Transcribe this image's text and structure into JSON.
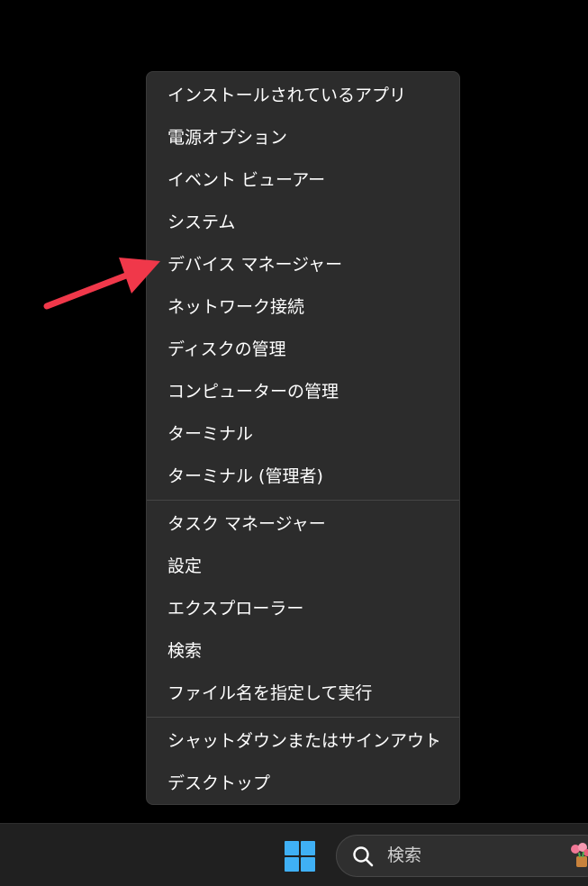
{
  "menu": {
    "group1": [
      {
        "name": "menu-item-installed-apps",
        "label": "インストールされているアプリ"
      },
      {
        "name": "menu-item-power-options",
        "label": "電源オプション"
      },
      {
        "name": "menu-item-event-viewer",
        "label": "イベント ビューアー"
      },
      {
        "name": "menu-item-system",
        "label": "システム"
      },
      {
        "name": "menu-item-device-manager",
        "label": "デバイス マネージャー"
      },
      {
        "name": "menu-item-network-connections",
        "label": "ネットワーク接続"
      },
      {
        "name": "menu-item-disk-management",
        "label": "ディスクの管理"
      },
      {
        "name": "menu-item-computer-management",
        "label": "コンピューターの管理"
      },
      {
        "name": "menu-item-terminal",
        "label": "ターミナル"
      },
      {
        "name": "menu-item-terminal-admin",
        "label": "ターミナル (管理者)"
      }
    ],
    "group2": [
      {
        "name": "menu-item-task-manager",
        "label": "タスク マネージャー"
      },
      {
        "name": "menu-item-settings",
        "label": "設定"
      },
      {
        "name": "menu-item-explorer",
        "label": "エクスプローラー"
      },
      {
        "name": "menu-item-search",
        "label": "検索"
      },
      {
        "name": "menu-item-run",
        "label": "ファイル名を指定して実行"
      }
    ],
    "group3": [
      {
        "name": "menu-item-shutdown-signout",
        "label": "シャットダウンまたはサインアウト",
        "submenu": true
      },
      {
        "name": "menu-item-desktop",
        "label": "デスクトップ"
      }
    ],
    "submenu_chevron": "›"
  },
  "taskbar": {
    "search_label": "検索",
    "start_icon": "windows-logo-icon",
    "search_icon": "search-icon",
    "tray_icon": "flower-icon"
  },
  "annotation": {
    "arrow_color": "#f0384a",
    "target": "menu-item-device-manager"
  },
  "colors": {
    "menu_bg": "#2c2c2c",
    "taskbar_bg": "#202020",
    "windows_blue": "#3fb0f5"
  }
}
